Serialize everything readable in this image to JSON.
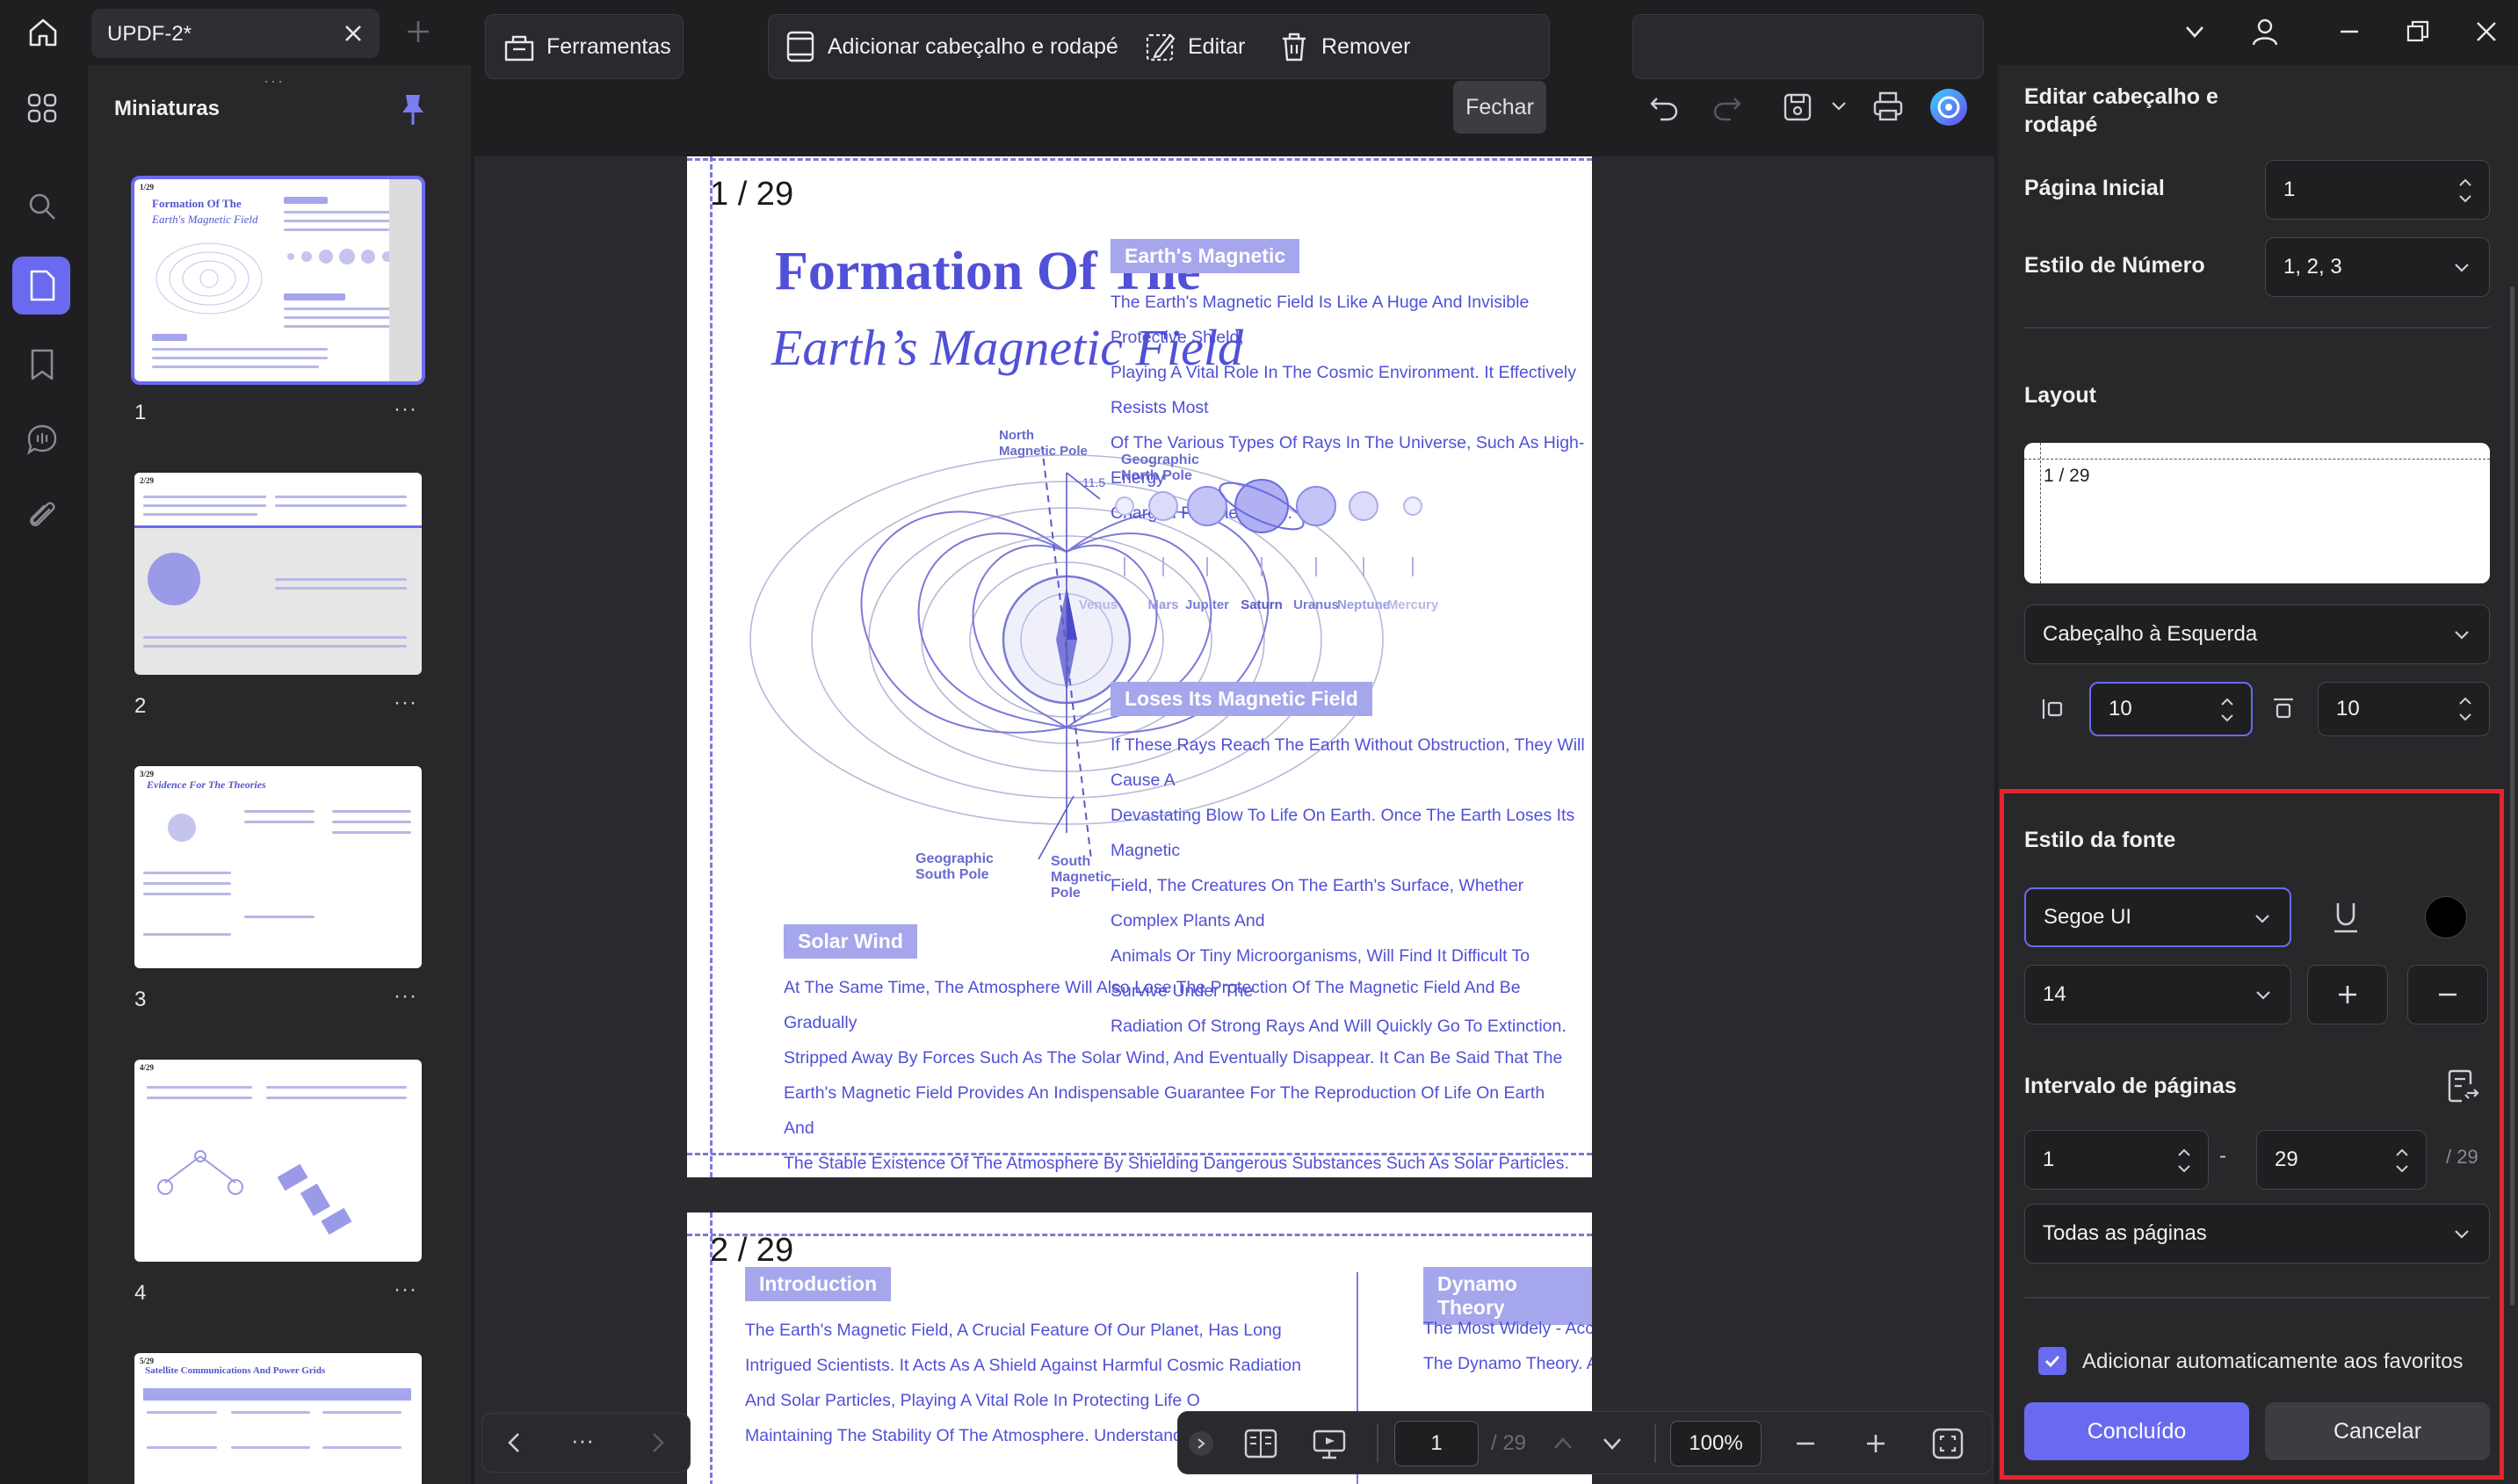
{
  "titlebar": {
    "tab_title": "UPDF-2*"
  },
  "thumbnails": {
    "title": "Miniaturas",
    "items": [
      {
        "number": "1",
        "mini_title": "Formation Of The",
        "mini_subtitle": "Earth's Magnetic Field",
        "page_tag": "1/29"
      },
      {
        "number": "2",
        "page_tag": "2/29"
      },
      {
        "number": "3",
        "mini_title": "Evidence For The Theories",
        "page_tag": "3/29"
      },
      {
        "number": "4",
        "page_tag": "4/29"
      },
      {
        "number": "",
        "mini_title": "Satellite Communications And Power Grids",
        "page_tag": "5/29"
      }
    ],
    "more": "···"
  },
  "toolbar": {
    "tools": "Ferramentas",
    "add_header_footer": "Adicionar cabeçalho e rodapé",
    "edit": "Editar",
    "remove": "Remover",
    "close": "Fechar"
  },
  "page1": {
    "label": "1 / 29",
    "title_line1": "Formation Of The",
    "title_line2": "Earth’s Magnetic Field",
    "diagram": {
      "north_magnetic_pole": [
        "North",
        "Magnetic Pole"
      ],
      "geographic_north_pole": [
        "Geographic",
        "North Pole"
      ],
      "angle": "11.5",
      "geographic_south_pole": [
        "Geographic",
        "South Pole"
      ],
      "south_magnetic_pole": [
        "South",
        "Magnetic",
        "Pole"
      ]
    },
    "sections": {
      "earths_magnetic": {
        "heading": "Earth's Magnetic",
        "lines": [
          "The Earth's Magnetic Field Is Like A Huge And Invisible Protective Shield,",
          "Playing A Vital Role In The Cosmic Environment. It Effectively Resists Most",
          "Of The Various Types Of Rays In The Universe, Such As High-Energy",
          "Charged Particle Flows."
        ]
      },
      "loses": {
        "heading": "Loses Its Magnetic Field",
        "lines": [
          "If These Rays Reach The Earth Without Obstruction, They Will Cause A",
          "Devastating Blow To Life On Earth. Once The Earth Loses Its Magnetic",
          "Field, The Creatures On The Earth's Surface, Whether Complex Plants And",
          "Animals Or Tiny Microorganisms, Will Find It Difficult To Survive Under The",
          "Radiation Of Strong Rays And Will Quickly Go To Extinction."
        ]
      },
      "solar_wind": {
        "heading": "Solar Wind",
        "lines": [
          "At The Same Time, The Atmosphere Will Also Lose The Protection Of The Magnetic Field And Be Gradually",
          "Stripped Away By Forces Such As The Solar Wind, And Eventually Disappear. It Can Be Said That The",
          "Earth's Magnetic Field Provides An Indispensable Guarantee For The Reproduction Of Life On Earth And",
          "The Stable Existence Of The Atmosphere By Shielding Dangerous Substances Such As Solar Particles."
        ]
      }
    },
    "planets": [
      "Venus",
      "Mars",
      "Jupiter",
      "Saturn",
      "Uranus",
      "Neptune",
      "Mercury"
    ]
  },
  "page2": {
    "label": "2 / 29",
    "intro": {
      "heading": "Introduction",
      "lines": [
        "The Earth's Magnetic Field, A Crucial Feature Of Our Planet, Has Long",
        "Intrigued Scientists. It Acts As A Shield Against Harmful Cosmic Radiation",
        "And Solar Particles, Playing A Vital Role In Protecting Life O",
        "Maintaining The Stability Of The Atmosphere. Understandin"
      ]
    },
    "dynamo": {
      "heading": "Dynamo Theory",
      "lines": [
        "The Most Widely - Accepted Theory For The Formation Of The Earth's Magnetic Fie",
        "The Dynamo Theory. At The Core Of This Theory Is The Motion Of Molten Iron And"
      ]
    }
  },
  "bottom_bar": {
    "page_value": "1",
    "page_total": "/ 29",
    "zoom": "100%",
    "more": "···"
  },
  "panel": {
    "title": "Editar cabeçalho e rodapé",
    "start_page_label": "Página Inicial",
    "start_page_value": "1",
    "number_style_label": "Estilo de Número",
    "number_style_value": "1, 2, 3",
    "layout_label": "Layout",
    "layout_preview_text": "1 / 29",
    "position_value": "Cabeçalho à Esquerda",
    "margin_left_value": "10",
    "margin_top_value": "10",
    "font_style_label": "Estilo da fonte",
    "font_value": "Segoe UI",
    "font_size_value": "14",
    "font_color": "#000000",
    "page_range_label": "Intervalo de páginas",
    "range_from": "1",
    "range_dash": "-",
    "range_to": "29",
    "range_total": "/ 29",
    "pages_filter_value": "Todas as páginas",
    "auto_add_favorites_label": "Adicionar automaticamente aos favoritos",
    "auto_add_favorites_checked": true,
    "done_label": "Concluído",
    "cancel_label": "Cancelar"
  },
  "colors": {
    "accent": "#6a6af0",
    "highlight_border": "#e8232f",
    "doc_text": "#5050d8"
  }
}
